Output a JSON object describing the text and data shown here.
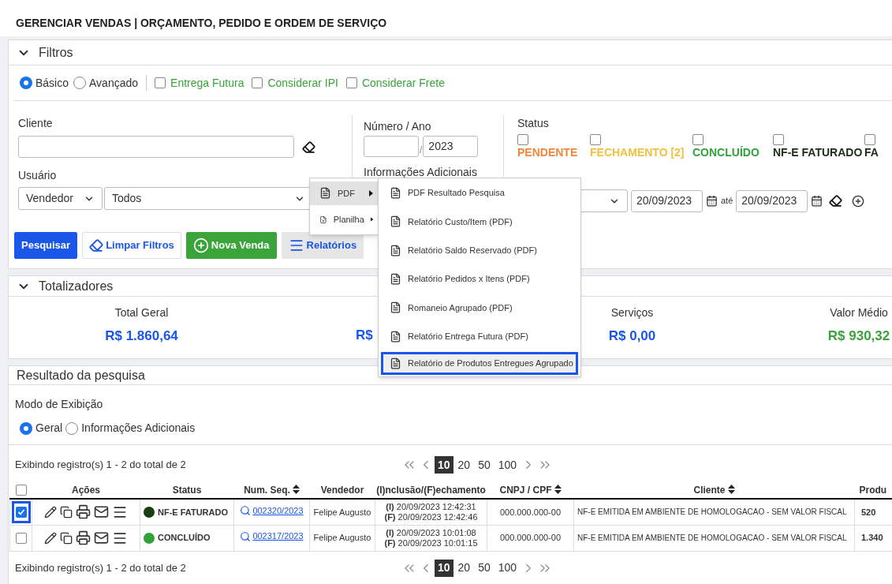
{
  "page_title": "GERENCIAR VENDAS | ORÇAMENTO, PEDIDO E ORDEM DE SERVIÇO",
  "filters": {
    "title": "Filtros",
    "expanded": true,
    "modes": [
      {
        "label": "Básico",
        "selected": true
      },
      {
        "label": "Avançado",
        "selected": false
      }
    ],
    "options": [
      {
        "label": "Entrega Futura",
        "checked": false
      },
      {
        "label": "Considerar IPI",
        "checked": false
      },
      {
        "label": "Considerar Frete",
        "checked": false
      }
    ],
    "client_label": "Cliente",
    "user_label": "Usuário",
    "user_type": "Vendedor",
    "user_value": "Todos",
    "number_label": "Número / Ano",
    "number_separator": "/",
    "year": "2023",
    "info_label": "Informações Adicionais",
    "status_label": "Status",
    "status_items": [
      {
        "label": "PENDENTE",
        "checked": false,
        "color": "#f0883a"
      },
      {
        "label": "FECHAMENTO [2]",
        "checked": false,
        "color": "#f4c040"
      },
      {
        "label": "CONCLUÍDO",
        "checked": false,
        "color": "#2fa33a"
      },
      {
        "label": "NF-E FATURADO",
        "checked": false,
        "color": "#1e2a1a"
      },
      {
        "label": "FA",
        "checked": false,
        "color": "#1e2a1a"
      }
    ],
    "date_from": "20/09/2023",
    "to_label": "até",
    "date_to": "20/09/2023",
    "buttons": [
      {
        "label": "Pesquisar",
        "kind": "primary"
      },
      {
        "label": "Limpar Filtros",
        "kind": "clear"
      },
      {
        "label": "Nova Venda",
        "kind": "new"
      },
      {
        "label": "Relatórios",
        "kind": "menu"
      }
    ]
  },
  "reports_menu": {
    "items": [
      {
        "label": "PDF",
        "kind": "pdf",
        "expanded": true
      },
      {
        "label": "Planilha",
        "kind": "sheet",
        "expanded": false
      }
    ],
    "submenu": [
      {
        "label": "PDF Resultado Pesquisa",
        "selected": false
      },
      {
        "label": "Relatório Custo/Item (PDF)",
        "selected": false
      },
      {
        "label": "Relatório Saldo Reservado (PDF)",
        "selected": false
      },
      {
        "label": "Relatório Pedidos x Itens (PDF)",
        "selected": false
      },
      {
        "label": "Romaneio Agrupado (PDF)",
        "selected": false
      },
      {
        "label": "Relatório Entrega Futura (PDF)",
        "selected": false
      },
      {
        "label": "Relatório de Produtos Entregues Agrupado",
        "selected": true
      }
    ]
  },
  "totals": {
    "title": "Totalizadores",
    "expanded": true,
    "items": [
      {
        "label": "Total Geral",
        "value": "R$ 1.860,64",
        "color": "#1a56e8"
      },
      {
        "value": "R$",
        "color": "#1a56e8"
      },
      {
        "label": "Serviços",
        "value": "R$ 0,00",
        "color": "#1a56e8"
      },
      {
        "label": "Valor Médio",
        "value": "R$ 930,32",
        "color": "#3aa33a"
      }
    ]
  },
  "results": {
    "title": "Resultado da pesquisa",
    "mode_label": "Modo de Exibição",
    "modes": [
      {
        "label": "Geral",
        "selected": true
      },
      {
        "label": "Informações Adicionais",
        "selected": false
      }
    ],
    "summary_top": "Exibindo registro(s) 1 - 2 do total de 2",
    "summary_bottom": "Exibindo registro(s) 1 - 2 do total de 2",
    "page_sizes_top": [
      {
        "label": "10",
        "selected": true
      },
      {
        "label": "20",
        "selected": false
      },
      {
        "label": "50",
        "selected": false
      },
      {
        "label": "100",
        "selected": false
      }
    ],
    "page_sizes_bottom": [
      {
        "label": "10",
        "selected": true
      },
      {
        "label": "20",
        "selected": false
      },
      {
        "label": "50",
        "selected": false
      },
      {
        "label": "100",
        "selected": false
      }
    ],
    "all_checked": false,
    "columns": [
      {
        "label": "Ações",
        "sortable": false
      },
      {
        "label": "Status",
        "sortable": false
      },
      {
        "label": "Num. Seq.",
        "sortable": true
      },
      {
        "label": "Vendedor",
        "sortable": false
      },
      {
        "label": "(I)nclusão/(F)echamento",
        "sortable": false
      },
      {
        "label": "CNPJ / CPF",
        "sortable": true
      },
      {
        "label": "Cliente",
        "sortable": true
      },
      {
        "label": "Produ",
        "sortable": false
      }
    ],
    "rows": [
      {
        "selected": true,
        "status": "NF-E FATURADO",
        "color": "#1b3d12",
        "number": "002320/2023",
        "seller": "Felipe Augusto",
        "inclusion": "**(I)** 20/09/2023 12:42:31",
        "closing": "**(F)** 20/09/2023 12:42:46",
        "cnpj": "000.000.000-00",
        "client": "NF-E EMITIDA EM AMBIENTE DE HOMOLOGACAO - SEM VALOR FISCAL",
        "products": "520"
      },
      {
        "selected": false,
        "status": "CONCLUÍDO",
        "color": "#2fa33a",
        "number": "002317/2023",
        "seller": "Felipe Augusto",
        "inclusion": "**(I)** 20/09/2023 10:01:08",
        "closing": "**(F)** 20/09/2023 10:01:15",
        "cnpj": "000.000.000-00",
        "client": "NF-E EMITIDA EM AMBIENTE DE HOMOLOGACAO - SEM VALOR FISCAL",
        "products": "1.340"
      }
    ]
  }
}
